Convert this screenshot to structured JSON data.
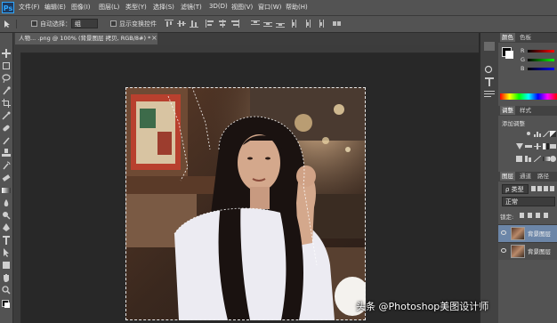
{
  "app": {
    "logo_text": "Ps"
  },
  "menubar": {
    "items": [
      "文件(F)",
      "编辑(E)",
      "图像(I)",
      "图层(L)",
      "类型(Y)",
      "选择(S)",
      "滤镜(T)",
      "3D(D)",
      "视图(V)",
      "窗口(W)",
      "帮助(H)"
    ]
  },
  "options": {
    "auto_select_label": "自动选择：",
    "auto_select_value": "组",
    "show_transform_label": "显示变换控件"
  },
  "document": {
    "tab_title": "人物... .png @ 100% (背景图层 拷贝, RGB/8#) *",
    "close_glyph": "×"
  },
  "panels": {
    "color_tabs": [
      "颜色",
      "色板"
    ],
    "color_channels": [
      "R",
      "G",
      "B"
    ],
    "adjust_tabs": [
      "调整",
      "样式"
    ],
    "adjust_title": "添加调整",
    "layer_tabs": [
      "图层",
      "通道",
      "路径"
    ],
    "kind_label": "ρ 类型",
    "blend_mode": "正常",
    "lock_label": "锁定:",
    "layers": [
      {
        "name": "背景图层",
        "selected": true
      },
      {
        "name": "背景图层",
        "selected": false
      }
    ]
  },
  "watermark": {
    "text": "头条 @Photoshop美图设计师"
  },
  "colors": {
    "menubar": "#535353",
    "panel": "#535353",
    "canvas_bg": "#282828",
    "selected_layer": "#6c86a8"
  }
}
